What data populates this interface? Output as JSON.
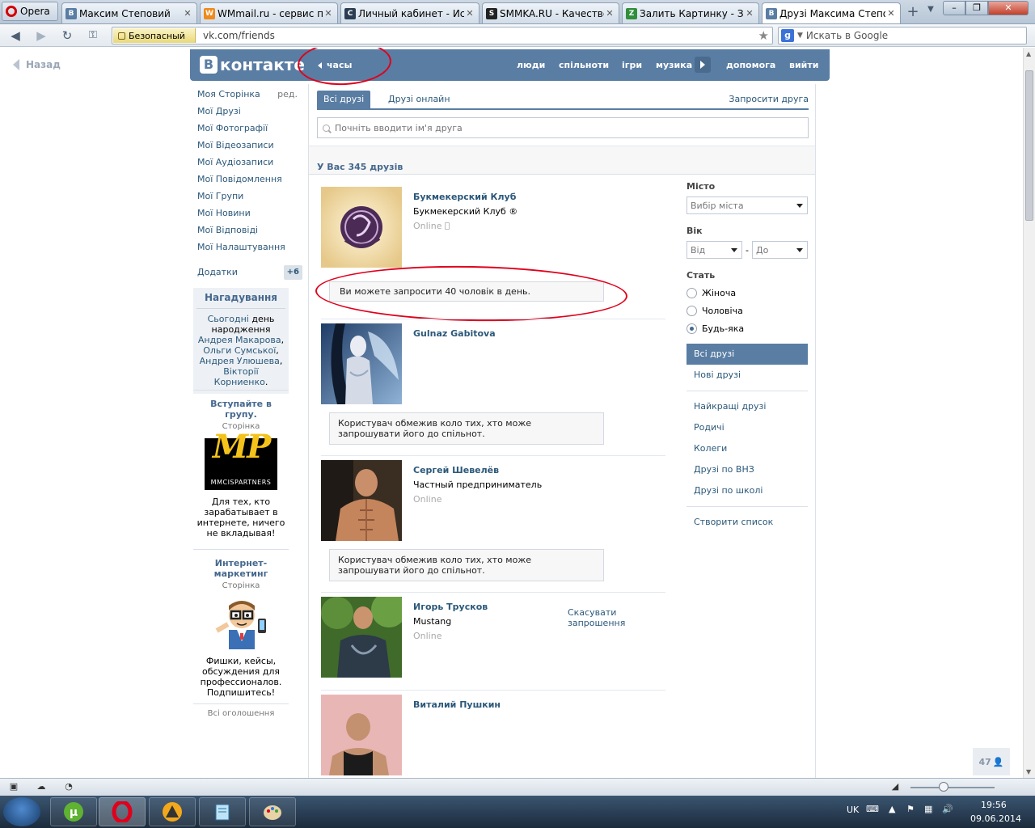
{
  "browser": {
    "menu_label": "Opera",
    "tabs": [
      {
        "title": "Максим Степовий",
        "favicon": "B",
        "color": "#597da3"
      },
      {
        "title": "WMmail.ru - сервис п...",
        "favicon": "W",
        "color": "#f08a1c"
      },
      {
        "title": "Личный кабинет - Ис...",
        "favicon": "C",
        "color": "#2a3d52"
      },
      {
        "title": "SMMKA.RU - Качестве...",
        "favicon": "S",
        "color": "#222"
      },
      {
        "title": "Залить Картинку - Заг...",
        "favicon": "Z",
        "color": "#2f8f3a"
      },
      {
        "title": "Друзі Максима Степо...",
        "favicon": "B",
        "color": "#597da3"
      }
    ],
    "secure_label": "Безопасный",
    "url": "vk.com/friends",
    "search_placeholder": "Искать в Google"
  },
  "page": {
    "back_label": "Назад",
    "header": {
      "logo_text": "контакте",
      "logo_letter": "B",
      "clock_label": "часы",
      "nav": [
        "люди",
        "спільноти",
        "ігри",
        "музика",
        "допомога",
        "вийти"
      ]
    },
    "left_menu": {
      "items": [
        "Моя Сторінка",
        "Мої Друзі",
        "Мої Фотографії",
        "Мої Відеозаписи",
        "Мої Аудіозаписи",
        "Мої Повідомлення",
        "Мої Групи",
        "Мої Новини",
        "Мої Відповіді",
        "Мої Налаштування"
      ],
      "edit_label": "ред.",
      "apps_label": "Додатки",
      "apps_badge": "+6"
    },
    "reminder": {
      "title": "Нагадування",
      "today": "Сьогодні",
      "text_day": " день народження ",
      "names": [
        "Андрея Макарова",
        "Ольги Сумської",
        "Андрея Улюшева",
        "Вікторії Корниенко"
      ]
    },
    "ads": [
      {
        "title": "Вступайте в групу.",
        "subtitle": "Сторінка",
        "logo_text": "MP",
        "logo_caption": "MMCISPARTNERS",
        "text": "Для тех, кто зарабатывает в интернете, ничего не вкладывая!"
      },
      {
        "title": "Интернет-маркетинг",
        "subtitle": "Сторінка",
        "text": "Фишки, кейсы, обсуждения для профессионалов. Подпишитесь!"
      }
    ],
    "all_ads_label": "Всі оголошення",
    "friends": {
      "tabs": {
        "all": "Всі друзі",
        "online": "Друзі онлайн",
        "invite": "Запросити друга"
      },
      "search_placeholder": "Почніть вводити ім'я друга",
      "count_label": "У Вас 345 друзів",
      "list": [
        {
          "name": "Букмекерский Клуб",
          "desc": "Букмекерский Клуб ®",
          "status": "Online",
          "message": "Ви можете запросити 40 чоловік в день.",
          "action": ""
        },
        {
          "name": "Gulnaz Gabitova",
          "desc": "",
          "status": "",
          "message": "Користувач обмежив коло тих, хто може запрошувати його до спільнот.",
          "action": ""
        },
        {
          "name": "Сергей Шевелёв",
          "desc": "Частный предприниматель",
          "status": "Online",
          "message": "Користувач обмежив коло тих, хто може запрошувати його до спільнот.",
          "action": ""
        },
        {
          "name": "Игорь Трусков",
          "desc": "Mustang",
          "status": "Online",
          "message": "",
          "action": "Скасувати запрошення"
        },
        {
          "name": "Виталий Пушкин",
          "desc": "",
          "status": "",
          "message": "",
          "action": ""
        }
      ]
    },
    "filters": {
      "city_label": "Місто",
      "city_value": "Вибір міста",
      "age_label": "Вік",
      "age_from": "Від",
      "age_dash": "-",
      "age_to": "До",
      "sex_label": "Стать",
      "sex_options": [
        "Жіноча",
        "Чоловіча",
        "Будь-яка"
      ],
      "sex_selected": 2,
      "lists": [
        "Всі друзі",
        "Нові друзі"
      ],
      "groups": [
        "Найкращі друзі",
        "Родичі",
        "Колеги",
        "Друзі по ВНЗ",
        "Друзі по школі"
      ],
      "create_list": "Створити список"
    },
    "online_badge": "47"
  },
  "taskbar": {
    "lang": "UK",
    "time": "19:56",
    "date": "09.06.2014"
  }
}
